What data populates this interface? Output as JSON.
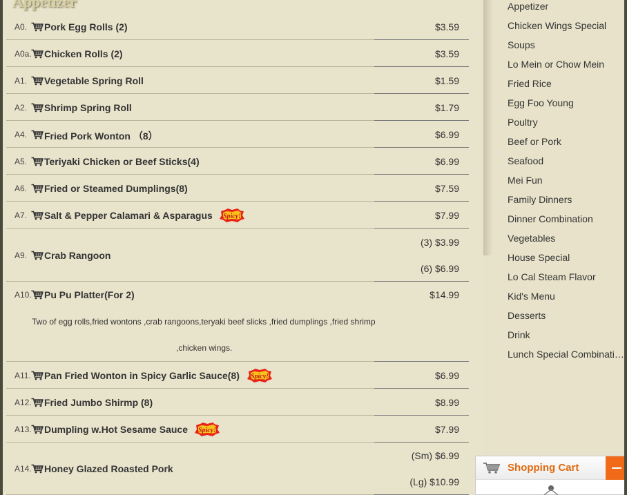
{
  "section": {
    "title": "Appetizer"
  },
  "items": [
    {
      "code": "A0.",
      "name": "Pork Egg Rolls (2)",
      "price": "$3.59"
    },
    {
      "code": "A0a.",
      "name": "Chicken Rolls (2)",
      "price": "$3.59"
    },
    {
      "code": "A1.",
      "name": "Vegetable Spring Roll",
      "price": "$1.59"
    },
    {
      "code": "A2.",
      "name": "Shrimp Spring Roll",
      "price": "$1.79"
    },
    {
      "code": "A4.",
      "name": "Fried Pork Wonton （8）",
      "price": "$6.99"
    },
    {
      "code": "A5.",
      "name": "Teriyaki Chicken or Beef Sticks(4)",
      "price": "$6.99"
    },
    {
      "code": "A6.",
      "name": "Fried or Steamed Dumplings(8)",
      "price": "$7.59"
    },
    {
      "code": "A7.",
      "name": "Salt & Pepper Calamari & Asparagus",
      "price": "$7.99",
      "spicy": true
    },
    {
      "code": "A9.",
      "name": "Crab Rangoon",
      "price_small": "(3) $3.99",
      "price_large": "(6) $6.99"
    },
    {
      "code": "A10.",
      "name": "Pu Pu Platter(For 2)",
      "price": "$14.99",
      "description_line1": "Two of egg rolls,fried wontons ,crab rangoons,teryaki beef slicks ,fried dumplings ,fried shrimp",
      "description_line2": ",chicken wings."
    },
    {
      "code": "A11.",
      "name": "Pan Fried Wonton in Spicy Garlic Sauce(8)",
      "price": "$6.99",
      "spicy": true
    },
    {
      "code": "A12.",
      "name": "Fried Jumbo Shirmp (8)",
      "price": "$8.99"
    },
    {
      "code": "A13.",
      "name": "Dumpling w.Hot Sesame Sauce",
      "price": "$7.99",
      "spicy": true
    },
    {
      "code": "A14.",
      "name": "Honey Glazed Roasted Pork",
      "price_small": "(Sm) $6.99",
      "price_large": "(Lg) $10.99"
    }
  ],
  "spicy_label": "Spicy!",
  "sidebar": {
    "categories": [
      "Appetizer",
      "Chicken Wings Special",
      "Soups",
      "Lo Mein or Chow Mein",
      "Fried Rice",
      "Egg Foo Young",
      "Poultry",
      "Beef or Pork",
      "Seafood",
      "Mei Fun",
      "Family Dinners",
      "Dinner Combination",
      "Vegetables",
      "House Special",
      "Lo Cal Steam Flavor",
      "Kid's Menu",
      "Desserts",
      "Drink",
      "Lunch Special Combination"
    ]
  },
  "cart_widget": {
    "title": "Shopping Cart"
  },
  "colors": {
    "accent": "#f06a1a",
    "background": "#e8e3cb",
    "spicy": "#e8241a"
  },
  "icons": {
    "cart": "shopping-cart-icon",
    "spicy": "spicy-badge-icon",
    "minimize": "minimize-icon"
  }
}
